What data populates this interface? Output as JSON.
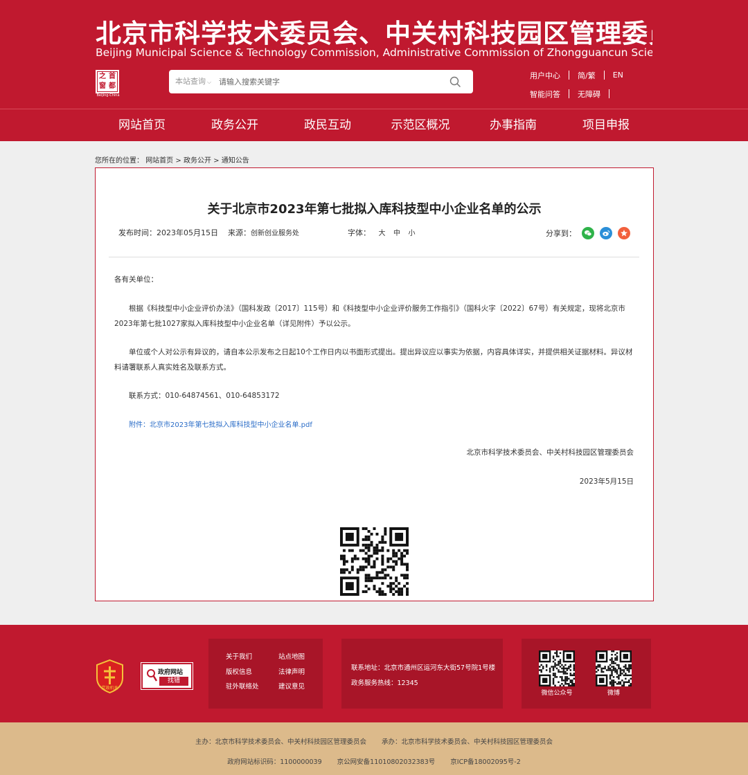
{
  "header": {
    "title_cn": "北京市科学技术委员会、中关村科技园区管理委员会",
    "title_en": "Beijing Municipal Science & Technology Commission, Administrative Commission of Zhongguancun Science Park",
    "logo_chars": [
      "之",
      "首",
      "窗",
      "都"
    ],
    "logo_caption": "Beijing-China",
    "search": {
      "scope": "本站查询",
      "placeholder": "请输入搜索关键字"
    },
    "links_row1": [
      "用户中心",
      "简/繁",
      "EN"
    ],
    "links_row2": [
      "智能问答",
      "无障碍"
    ]
  },
  "nav": [
    "网站首页",
    "政务公开",
    "政民互动",
    "示范区概况",
    "办事指南",
    "项目申报"
  ],
  "breadcrumb": {
    "prefix": "您所在的位置：",
    "items": [
      "网站首页",
      "政务公开",
      "通知公告"
    ],
    "separator": ">"
  },
  "article": {
    "title": "关于北京市2023年第七批拟入库科技型中小企业名单的公示",
    "publish_label": "发布时间：",
    "publish_date": "2023年05月15日",
    "source_label": "来源：",
    "source": "创新创业服务处",
    "font_label": "字体：",
    "font_options": [
      "大",
      "中",
      "小"
    ],
    "share_label": "分享到：",
    "salutation": "各有关单位：",
    "para1": "根据《科技型中小企业评价办法》（国科发政〔2017〕115号）和《科技型中小企业评价服务工作指引》（国科火字〔2022〕67号）有关规定，现将北京市2023年第七批1027家拟入库科技型中小企业名单（详见附件）予以公示。",
    "para2": "单位或个人对公示有异议的，请自本公示发布之日起10个工作日内以书面形式提出。提出异议应以事实为依据，内容具体详实，并提供相关证据材料。异议材料请署联系人真实姓名及联系方式。",
    "contact": "联系方式：010-64874561、010-64853172",
    "attachment": "附件：北京市2023年第七批拟入库科技型中小企业名单.pdf",
    "signature": "北京市科学技术委员会、中关村科技园区管理委员会",
    "sign_date": "2023年5月15日"
  },
  "footer": {
    "gov_error_top": "政府网站",
    "gov_error_bottom": "找错",
    "party_logo_text": "党政机关",
    "links": [
      "关于我们",
      "站点地图",
      "版权信息",
      "法律声明",
      "驻外联络处",
      "建议意见"
    ],
    "address": "联系地址：北京市通州区运河东大街57号院1号楼",
    "hotline": "政务服务热线：12345",
    "qr_labels": [
      "微信公众号",
      "微博"
    ],
    "sponsor": "主办：北京市科学技术委员会、中关村科技园区管理委员会",
    "organizer": "承办：北京市科学技术委员会、中关村科技园区管理委员会",
    "site_id": "政府网站标识码：1100000039",
    "police_record": "京公网安备11010802032383号",
    "icp": "京ICP备18002095号-2"
  },
  "colors": {
    "brand_red": "#c0192f",
    "panel_red": "#a81528",
    "footer_gold": "#dcba8b",
    "link_blue": "#2a6cc7"
  }
}
